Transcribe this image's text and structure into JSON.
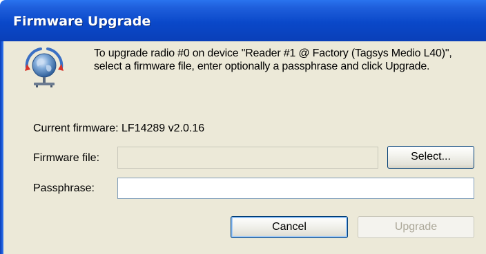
{
  "window": {
    "title": "Firmware Upgrade"
  },
  "app_icon": "globe-network-icon",
  "intro_text": "To upgrade radio #0 on device \"Reader #1 @ Factory (Tagsys Medio L40)\", select a firmware file, enter optionally a passphrase and click Upgrade.",
  "current_firmware": {
    "text": "Current firmware: LF14289 v2.0.16"
  },
  "firmware_file": {
    "label": "Firmware file:",
    "value": "",
    "select_label": "Select..."
  },
  "passphrase": {
    "label": "Passphrase:",
    "value": ""
  },
  "buttons": {
    "cancel": "Cancel",
    "upgrade": "Upgrade"
  },
  "colors": {
    "titlebar": "#0a48c9",
    "dialog_bg": "#ece9d8",
    "disabled_text": "#aca899"
  }
}
